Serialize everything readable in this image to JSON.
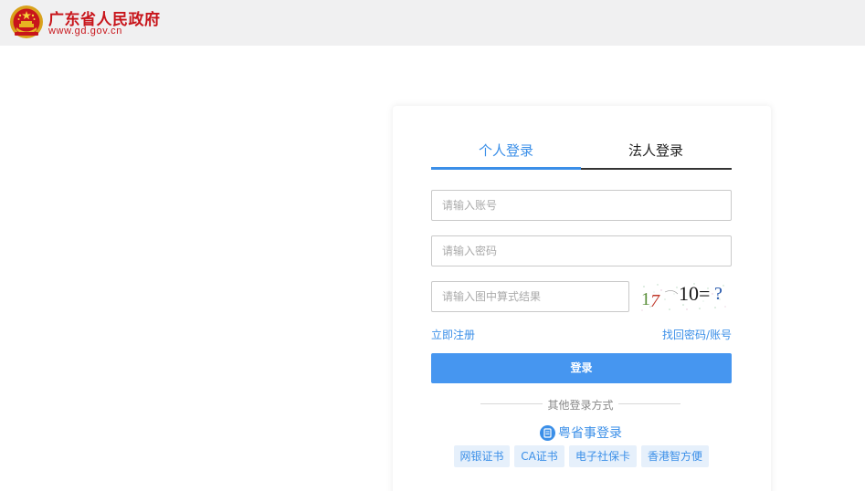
{
  "header": {
    "site_name": "广东省人民政府",
    "site_url": "www.gd.gov.cn"
  },
  "login": {
    "tabs": [
      {
        "label": "个人登录",
        "active": true
      },
      {
        "label": "法人登录",
        "active": false
      }
    ],
    "account_placeholder": "请输入账号",
    "password_placeholder": "请输入密码",
    "captcha_placeholder": "请输入图中算式结果",
    "captcha_text": "17 10=?",
    "register_label": "立即注册",
    "forgot_label": "找回密码/账号",
    "submit_label": "登录",
    "other_methods_label": "其他登录方式",
    "yss_label": "粤省事登录",
    "alt_methods": [
      "网银证书",
      "CA证书",
      "电子社保卡",
      "香港智方便"
    ]
  },
  "colors": {
    "brand_red": "#c8151b",
    "accent_blue": "#3b8fe8",
    "button_blue": "#4696f0",
    "topbar_bg": "#f0f0f1"
  },
  "icons": {
    "emblem": "national-emblem-icon",
    "yss": "yuesheng-shi-icon"
  }
}
